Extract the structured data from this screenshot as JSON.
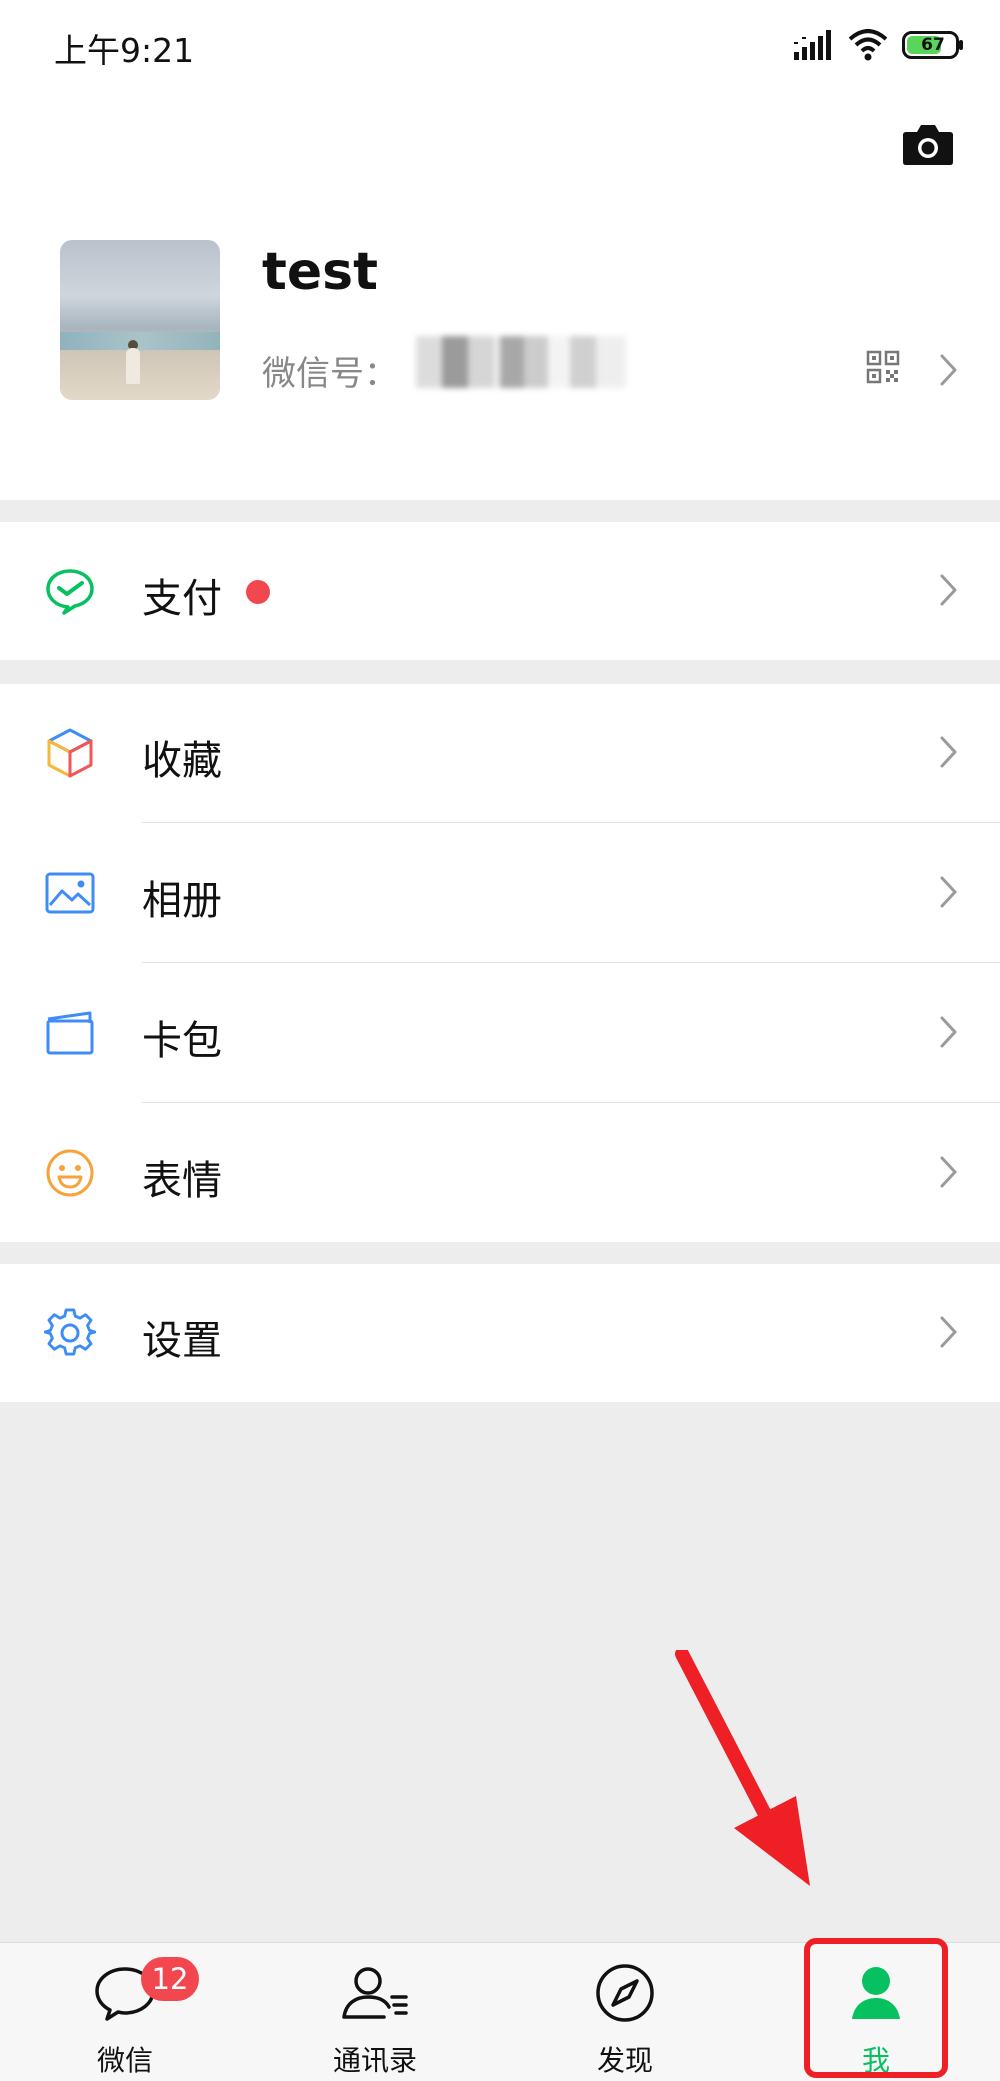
{
  "status_bar": {
    "time": "上午9:21",
    "battery": "67",
    "icons": [
      "signal-icon",
      "wifi-icon",
      "battery-icon"
    ]
  },
  "profile": {
    "nickname": "test",
    "wechat_id_label": "微信号：",
    "icons": [
      "camera-icon",
      "qr-code-icon",
      "chevron-right-icon"
    ]
  },
  "menu": {
    "pay": {
      "label": "支付",
      "icon": "wechat-pay-icon",
      "has_red_dot": true
    },
    "favorites": {
      "label": "收藏",
      "icon": "cube-icon"
    },
    "album": {
      "label": "相册",
      "icon": "picture-icon"
    },
    "cards": {
      "label": "卡包",
      "icon": "card-wallet-icon"
    },
    "stickers": {
      "label": "表情",
      "icon": "smiley-icon"
    },
    "settings": {
      "label": "设置",
      "icon": "gear-icon"
    }
  },
  "tabbar": {
    "tabs": [
      {
        "label": "微信",
        "icon": "chat-bubble-icon",
        "badge": "12"
      },
      {
        "label": "通讯录",
        "icon": "contacts-icon"
      },
      {
        "label": "发现",
        "icon": "compass-icon"
      },
      {
        "label": "我",
        "icon": "person-icon",
        "active": true
      }
    ]
  },
  "colors": {
    "accent_green": "#07c160",
    "badge_red": "#f2474f",
    "annotation_red": "#ee1f25",
    "background": "#ededed"
  }
}
